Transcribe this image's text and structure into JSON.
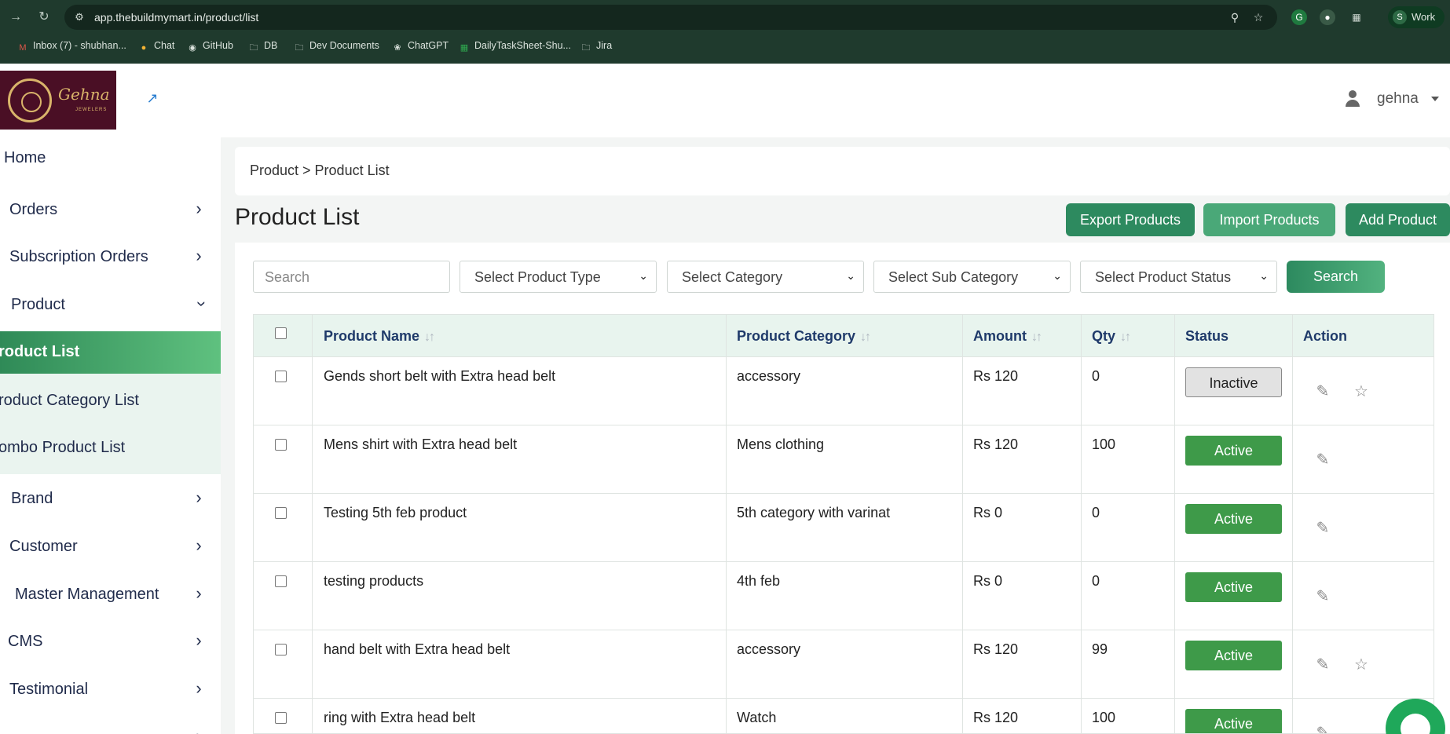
{
  "browser": {
    "url": "app.thebuildmymart.in/product/list",
    "profile_label": "Work",
    "profile_initial": "S",
    "bookmarks": [
      {
        "label": "Inbox (7) - shubhan...",
        "icon": "gmail-icon"
      },
      {
        "label": "Chat",
        "icon": "chat-icon"
      },
      {
        "label": "GitHub",
        "icon": "github-icon"
      },
      {
        "label": "DB",
        "icon": "folder-icon"
      },
      {
        "label": "Dev Documents",
        "icon": "folder-icon"
      },
      {
        "label": "ChatGPT",
        "icon": "chatgpt-icon"
      },
      {
        "label": "DailyTaskSheet-Shu...",
        "icon": "sheets-icon"
      },
      {
        "label": "Jira",
        "icon": "folder-icon"
      }
    ]
  },
  "header": {
    "logo_text": "Gehna",
    "logo_subtext": "JEWELERS",
    "username": "gehna"
  },
  "sidebar": {
    "items": [
      {
        "label": "Home"
      },
      {
        "label": "Orders"
      },
      {
        "label": "Subscription Orders"
      },
      {
        "label": "Product"
      },
      {
        "label": "Brand"
      },
      {
        "label": "Customer"
      },
      {
        "label": "Master Management"
      },
      {
        "label": "CMS"
      },
      {
        "label": "Testimonial"
      }
    ],
    "sub_items": [
      {
        "label": "roduct List"
      },
      {
        "label": "roduct Category List"
      },
      {
        "label": "ombo Product List"
      }
    ]
  },
  "breadcrumb": "Product > Product List",
  "page_title": "Product List",
  "actions": {
    "export": "Export Products",
    "import": "Import Products",
    "add": "Add Product"
  },
  "filters": {
    "search_placeholder": "Search",
    "product_type": "Select Product Type",
    "category": "Select Category",
    "sub_category": "Select Sub Category",
    "status": "Select Product Status",
    "search_button": "Search"
  },
  "table": {
    "columns": [
      "Product Name",
      "Product Category",
      "Amount",
      "Qty",
      "Status",
      "Action"
    ],
    "rows": [
      {
        "name": "Gends short belt with Extra head belt",
        "category": "accessory",
        "amount": "Rs 120",
        "qty": "0",
        "status": "Inactive"
      },
      {
        "name": "Mens shirt with Extra head belt",
        "category": "Mens clothing",
        "amount": "Rs 120",
        "qty": "100",
        "status": "Active"
      },
      {
        "name": "Testing 5th feb product",
        "category": "5th category with varinat",
        "amount": "Rs 0",
        "qty": "0",
        "status": "Active"
      },
      {
        "name": "testing products",
        "category": "4th feb",
        "amount": "Rs 0",
        "qty": "0",
        "status": "Active"
      },
      {
        "name": "hand belt with Extra head belt",
        "category": "accessory",
        "amount": "Rs 120",
        "qty": "99",
        "status": "Active"
      },
      {
        "name": "ring with Extra head belt",
        "category": "Watch",
        "amount": "Rs 120",
        "qty": "100",
        "status": "Active"
      }
    ]
  },
  "colors": {
    "brand_green": "#2d8a5f",
    "active_green": "#3e9a49",
    "logo_bg": "#4a0f25"
  }
}
